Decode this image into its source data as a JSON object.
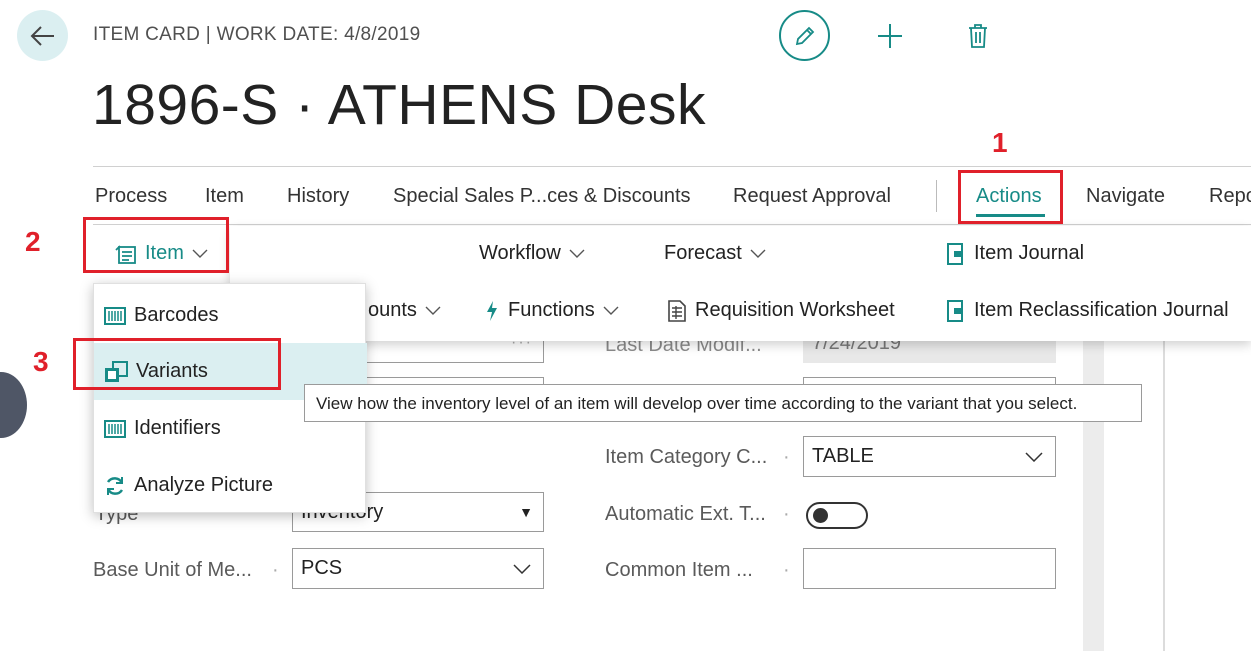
{
  "header": {
    "caption": "ITEM CARD | WORK DATE: 4/8/2019",
    "title": "1896-S · ATHENS Desk",
    "back_icon": "arrow-left-icon",
    "edit_icon": "pencil-icon",
    "add_icon": "plus-icon",
    "delete_icon": "trash-icon"
  },
  "tabs": [
    {
      "label": "Process"
    },
    {
      "label": "Item"
    },
    {
      "label": "History"
    },
    {
      "label": "Special Sales P...ces & Discounts"
    },
    {
      "label": "Request Approval"
    },
    {
      "label": "Actions"
    },
    {
      "label": "Navigate"
    },
    {
      "label": "Repo"
    }
  ],
  "annotations": {
    "one": "1",
    "two": "2",
    "three": "3"
  },
  "submenu": {
    "item_group": "Item",
    "workflow": "Workflow",
    "forecast": "Forecast",
    "item_journal": "Item Journal",
    "discounts_partial": "ounts",
    "functions": "Functions",
    "requisition_worksheet": "Requisition Worksheet",
    "item_reclass_journal": "Item Reclassification Journal"
  },
  "dropdown": {
    "items": [
      {
        "label": "Barcodes",
        "icon": "barcode-icon"
      },
      {
        "label": "Variants",
        "icon": "variants-icon"
      },
      {
        "label": "Identifiers",
        "icon": "barcode-icon"
      },
      {
        "label": "Analyze Picture",
        "icon": "refresh-icon"
      }
    ]
  },
  "tooltip": "View how the inventory level of an item will develop over time according to the variant that you select.",
  "form": {
    "last_date_label": "Last Date Modif...",
    "last_date_value": "7/24/2019",
    "item_category_label": "Item Category C...",
    "item_category_value": "TABLE",
    "type_label": "Type",
    "type_value": "Inventory",
    "auto_ext_label": "Automatic Ext. T...",
    "base_uom_label": "Base Unit of Me...",
    "base_uom_value": "PCS",
    "common_item_label": "Common Item ...",
    "common_item_value": "",
    "ellipsis": "···"
  },
  "colors": {
    "accent": "#178b87",
    "annotation": "#e0202a",
    "hover": "#dbeff1"
  }
}
